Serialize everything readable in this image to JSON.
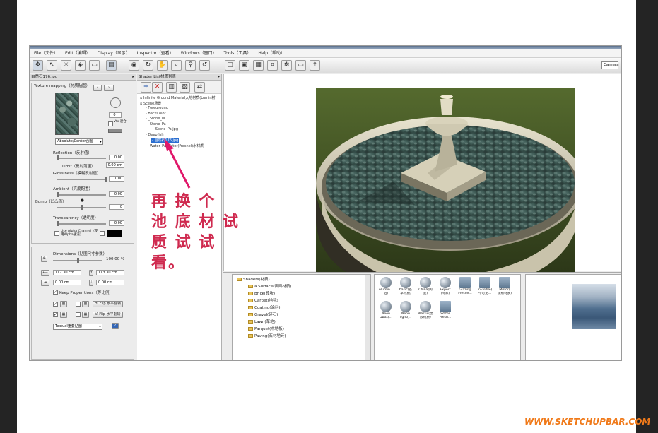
{
  "menu": [
    "File（文件）",
    "Edit（编辑）",
    "Display（显示）",
    "Inspector（查看）",
    "Windows（窗口）",
    "Tools（工具）",
    "Help（帮助）"
  ],
  "toolbar": {
    "camera_select": "Camera"
  },
  "left_panel": {
    "title": "自然石176.jpg",
    "texture_mapping_label": "Texture mapping（材质贴图）",
    "angle_value": "0",
    "tile_checkbox_label": "Vfx 混合",
    "mapping_dropdown": "Absolute/Center合图",
    "reflection_label": "Reflection（反射值）",
    "reflection_value": "0.00",
    "limit_label": "Limit（反射范围）：",
    "limit_value": "0.00 cm",
    "glossiness_label": "Glossiness（模糊反射值）",
    "glossiness_value": "1.00",
    "ambient_label": "Ambient（亮度配置）",
    "ambient_value": "0.00",
    "bump_label": "Bump（凹凸值）",
    "bump_value": "0",
    "transparency_label": "Transparency（透明度）",
    "transparency_value": "0.00",
    "alpha_label": "Use Alpha Channel（使用Alpha通道）",
    "dimensions_label": "Dimensions（贴图尺寸参数）",
    "dimensions_percent": "100.00 %",
    "width_value": "112.30 cm",
    "height_value": "113.30 cm",
    "offset_x": "0.00 cm",
    "offset_y": "0.00 cm",
    "keep_proportions_label": "Keep Proper tions（等比例）",
    "h_flip_label": "H. Flip 水平翻转",
    "v_flip_label": "V. Flip 水平翻转",
    "placement_dropdown": "Textual重叠贴图"
  },
  "shader_panel": {
    "title": "Shader List材质列表",
    "tree": [
      {
        "label": "Infinite Ground Material大地材质(Lumin材)",
        "level": 0
      },
      {
        "label": "Scene场景",
        "level": 0
      },
      {
        "label": "Foreground",
        "level": 1
      },
      {
        "label": "BackColor",
        "level": 1
      },
      {
        "label": "_Stone_M",
        "level": 1
      },
      {
        "label": "_Stone_Pa",
        "level": 1
      },
      {
        "label": "_Stone_Pa.jpg",
        "level": 2
      },
      {
        "label": "Deepfish",
        "level": 1
      },
      {
        "label": "自然石176.jpg",
        "level": 2,
        "selected": true
      },
      {
        "label": "_Water_Pa Water(Fresnel)水材质",
        "level": 1
      }
    ]
  },
  "annotation": {
    "line1": "再 换 个",
    "line2": "池 底 材 试",
    "line3": "质 试 试",
    "line4": "看。"
  },
  "library": {
    "root": "Shaders(材质)",
    "items": [
      "a Surface(表面材质)",
      "Brick(砖块)",
      "Carpet(地毯)",
      "Coating(涂料)",
      "Gravel(碎石)",
      "Lawn(草地)",
      "Parquet(木地板)",
      "Paving(石材地砖)"
    ]
  },
  "thumbnails": [
    {
      "name": "Alumin...",
      "sub": "铝)",
      "shape": "ball"
    },
    {
      "name": "basic(基",
      "sub": "本材质)",
      "shape": "ball"
    },
    {
      "name": "China(陶",
      "sub": "瓷)",
      "shape": "ball"
    },
    {
      "name": "Expert",
      "sub": "(专家)",
      "shape": "ball"
    },
    {
      "name": "Glazing",
      "sub": "Fresne...",
      "shape": "sq"
    },
    {
      "name": "Invisible(",
      "sub": "不可见...",
      "shape": "sq"
    },
    {
      "name": "Mirror(",
      "sub": "镜射材质)",
      "shape": "sq"
    },
    {
      "name": "Neon",
      "sub": "Dbox(...",
      "shape": "ball"
    },
    {
      "name": "Neon",
      "sub": "light(...",
      "shape": "ball"
    },
    {
      "name": "Plastic(塑",
      "sub": "胶材质)",
      "shape": "ball"
    },
    {
      "name": "Water",
      "sub": "Fresn...",
      "shape": "sq"
    }
  ],
  "watermark": "WWW.SKETCHUPBAR.COM"
}
